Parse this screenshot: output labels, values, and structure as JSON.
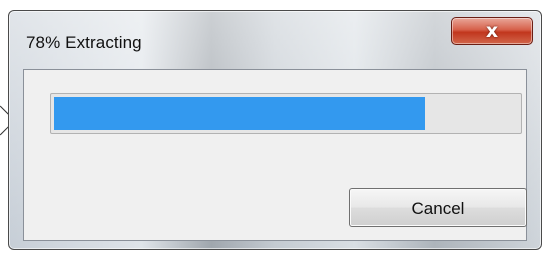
{
  "window": {
    "title": "78% Extracting",
    "close_glyph": "x"
  },
  "progress": {
    "fraction": 0.8
  },
  "buttons": {
    "cancel_label": "Cancel"
  },
  "colors": {
    "progress_fill": "#3399ef",
    "close_button": "#c1361d",
    "client_background": "#f0f0f0"
  },
  "icons": {
    "close": "close-icon"
  }
}
